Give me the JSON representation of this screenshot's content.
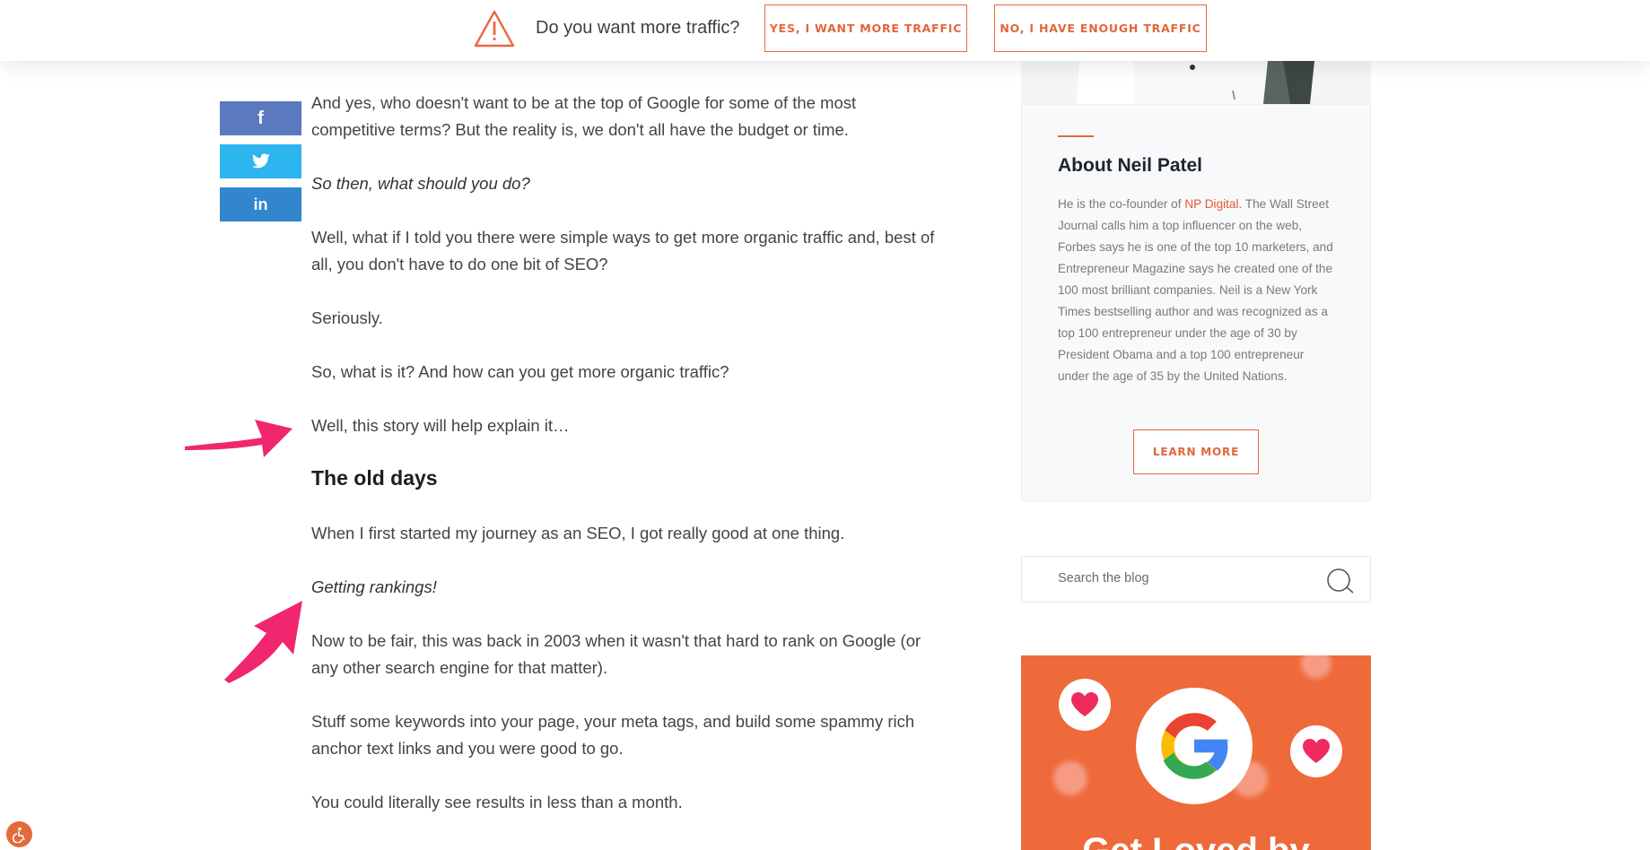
{
  "topbar": {
    "question": "Do you want more traffic?",
    "yes_label": "YES, I WANT MORE TRAFFIC",
    "no_label": "NO, I HAVE ENOUGH TRAFFIC"
  },
  "share": {
    "facebook_glyph": "f",
    "twitter_icon": "twitter-icon",
    "linkedin_glyph": "in"
  },
  "article": {
    "p1": "And yes, who doesn't want to be at the top of Google for some of the most competitive terms? But the reality is, we don't all have the budget or time.",
    "p2": "So then, what should you do?",
    "p3": "Well, what if I told you there were simple ways to get more organic traffic and, best of all, you don't have to do one bit of SEO?",
    "p4": "Seriously.",
    "p5": "So, what is it? And how can you get more organic traffic?",
    "p6": "Well, this story will help explain it…",
    "heading": "The old days",
    "p7": "When I first started my journey as an SEO, I got really good at one thing.",
    "p8": "Getting rankings!",
    "p9": "Now to be fair, this was back in 2003 when it wasn't that hard to rank on Google (or any other search engine for that matter).",
    "p10": "Stuff some keywords into your page, your meta tags, and build some spammy rich anchor text links and you were good to go.",
    "p11": "You could literally see results in less than a month."
  },
  "sidebar": {
    "author_title": "About Neil Patel",
    "bio_before_link": "He is the co-founder of ",
    "bio_link": "NP Digital",
    "bio_after_link": ". The Wall Street Journal calls him a top influencer on the web, Forbes says he is one of the top 10 marketers, and Entrepreneur Magazine says he created one of the 100 most brilliant companies. Neil is a New York Times bestselling author and was recognized as a top 100 entrepreneur under the age of 30 by President Obama and a top 100 entrepreneur under the age of 35 by the United Nations.",
    "learn_more": "LEARN MORE",
    "search_placeholder": "Search the blog",
    "promo_headline": "Get Loved by"
  },
  "colors": {
    "accent": "#e86a3f",
    "facebook": "#5b79bf",
    "twitter": "#2cb5ee",
    "linkedin": "#3186ce",
    "arrow": "#f0266f",
    "promo_bg": "#ee6a3a"
  }
}
